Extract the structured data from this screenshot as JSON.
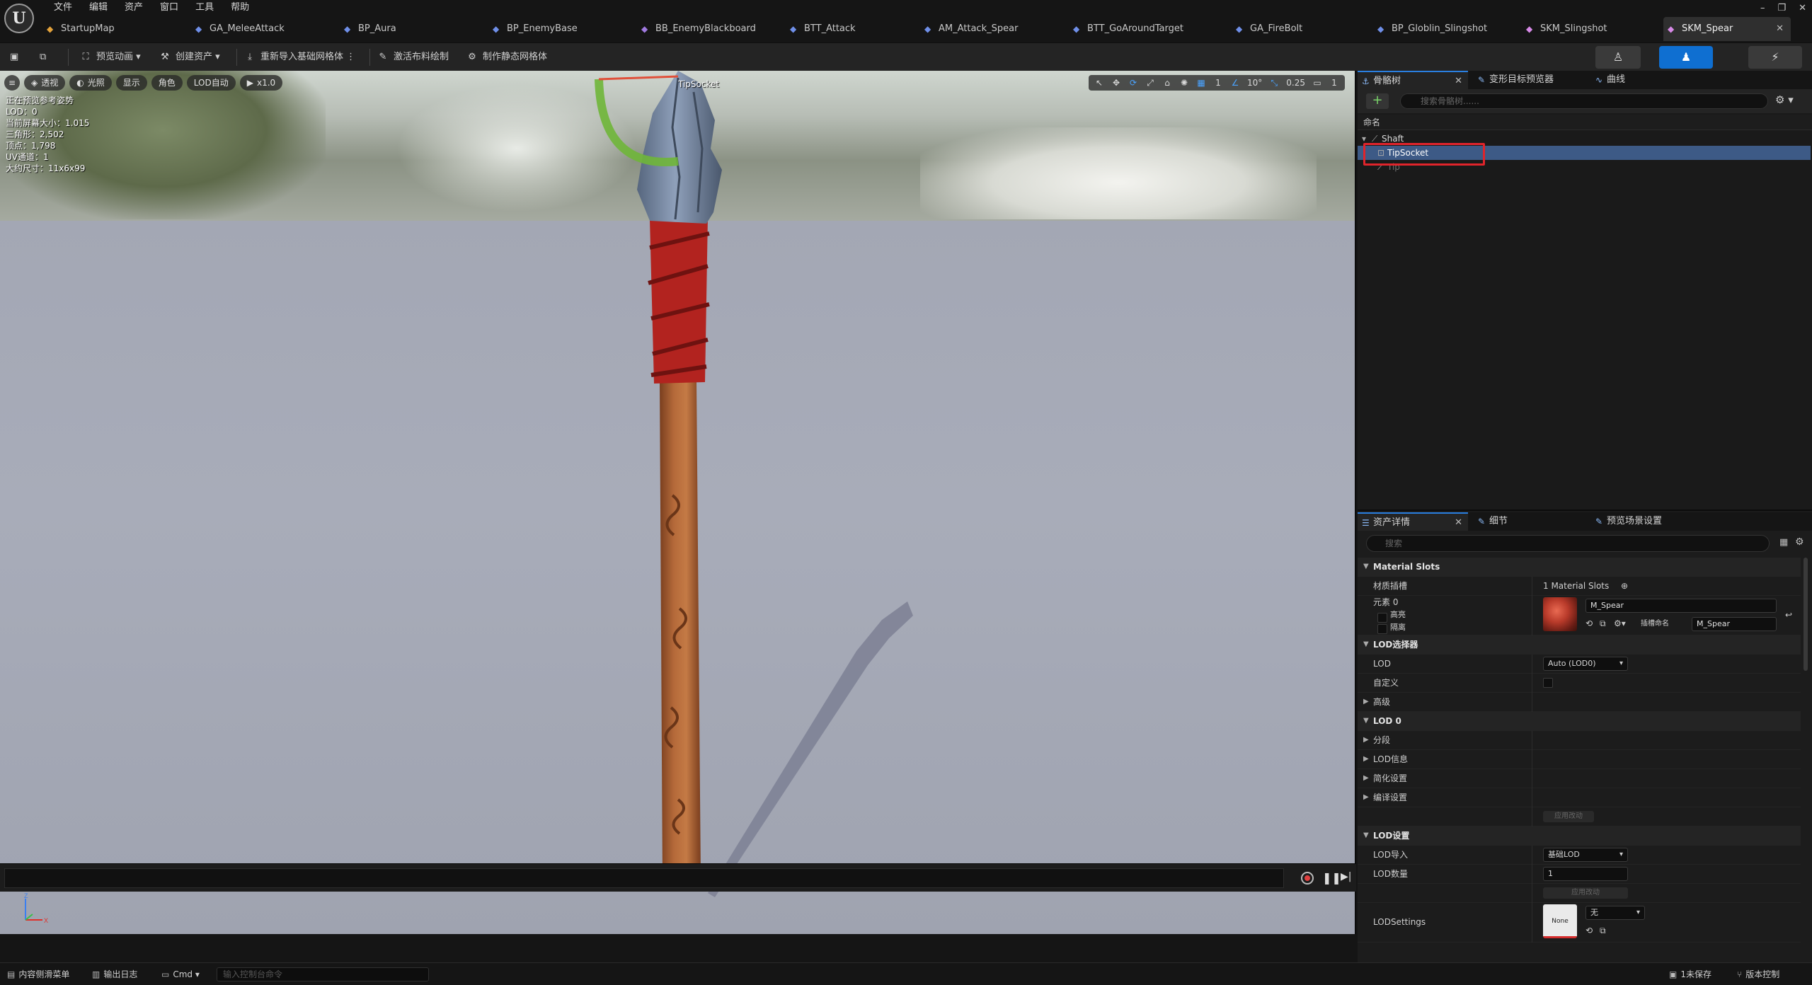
{
  "window": {
    "menu": [
      "文件",
      "编辑",
      "资产",
      "窗口",
      "工具",
      "帮助"
    ],
    "controls": [
      "–",
      "❐",
      "✕"
    ]
  },
  "tabs": [
    {
      "label": "StartupMap",
      "icon": "level-icon",
      "color": "#e3a23b"
    },
    {
      "label": "GA_MeleeAttack",
      "icon": "blueprint-icon",
      "color": "#6f8fe8"
    },
    {
      "label": "BP_Aura",
      "icon": "blueprint-icon",
      "color": "#6f8fe8"
    },
    {
      "label": "BP_EnemyBase",
      "icon": "blueprint-icon",
      "color": "#6f8fe8"
    },
    {
      "label": "BB_EnemyBlackboard",
      "icon": "blackboard-icon",
      "color": "#a07ae0"
    },
    {
      "label": "BTT_Attack",
      "icon": "blueprint-icon",
      "color": "#6f8fe8"
    },
    {
      "label": "AM_Attack_Spear",
      "icon": "montage-icon",
      "color": "#6f8fe8"
    },
    {
      "label": "BTT_GoAroundTarget",
      "icon": "blueprint-icon",
      "color": "#6f8fe8"
    },
    {
      "label": "GA_FireBolt",
      "icon": "blueprint-icon",
      "color": "#6f8fe8"
    },
    {
      "label": "BP_Globlin_Slingshot",
      "icon": "blueprint-icon",
      "color": "#6f8fe8"
    },
    {
      "label": "SKM_Slingshot",
      "icon": "skeletal-mesh-icon",
      "color": "#d88ae8"
    },
    {
      "label": "SKM_Spear",
      "icon": "skeletal-mesh-icon",
      "color": "#d88ae8",
      "active": true
    }
  ],
  "toolbar": {
    "preview_anim": "预览动画",
    "create_asset": "创建资产",
    "reimport_base_mesh": "重新导入基础网格体",
    "activate_cloth_paint": "激活布料绘制",
    "make_static_mesh": "制作静态网格体"
  },
  "viewport": {
    "pills": {
      "perspective": "透视",
      "lit": "光照",
      "show": "显示",
      "character": "角色",
      "lod_auto": "LOD自动",
      "speed": "x1.0"
    },
    "right_controls": {
      "layers": "1",
      "angle_snap": "10°",
      "scale_snap": "0.25",
      "camera_speed": "1"
    },
    "stats": [
      "正在预览参考姿势",
      "LOD：0",
      "当前屏幕大小：1.015",
      "三角形：2,502",
      "顶点：1,798",
      "UV通道：1",
      "大约尺寸：11x6x99"
    ],
    "socket_label": "TipSocket",
    "axis": {
      "z": "Z",
      "x": "X",
      "y": "Y"
    }
  },
  "skeleton_panel": {
    "tabs": [
      "骨骼树",
      "变形目标预览器",
      "曲线"
    ],
    "search_placeholder": "搜索骨骼树......",
    "column_header": "命名",
    "tree": [
      {
        "label": "Shaft",
        "level": 0,
        "type": "bone"
      },
      {
        "label": "TipSocket",
        "level": 1,
        "type": "socket",
        "selected": true
      },
      {
        "label": "Tip",
        "level": 1,
        "type": "bone",
        "dim": true
      }
    ]
  },
  "details_panel": {
    "tabs": [
      "资产详情",
      "细节",
      "预览场景设置"
    ],
    "search_placeholder": "搜索",
    "material_slots": {
      "category": "Material Slots",
      "label": "材质插槽",
      "count": "1 Material Slots",
      "element": "元素 0",
      "highlight": "高亮",
      "isolate": "隔离",
      "material": "M_Spear",
      "slot_name_label": "插槽命名",
      "slot_name": "M_Spear"
    },
    "lod_picker": {
      "category": "LOD选择器",
      "lod_label": "LOD",
      "lod_value": "Auto (LOD0)",
      "custom_label": "自定义",
      "advanced": "高级"
    },
    "lod0": {
      "category": "LOD 0",
      "sections": "分段",
      "lod_info": "LOD信息",
      "reduction": "简化设置",
      "build": "编译设置",
      "apply": "应用改动"
    },
    "lod_settings": {
      "category": "LOD设置",
      "import_label": "LOD导入",
      "import_value": "基础LOD",
      "count_label": "LOD数量",
      "count_value": "1",
      "apply": "应用改动",
      "settings_label": "LODSettings",
      "settings_thumb": "None",
      "settings_value": "无"
    }
  },
  "statusbar": {
    "content_drawer": "内容侧滑菜单",
    "output_log": "输出日志",
    "cmd": "Cmd",
    "cmd_placeholder": "输入控制台命令",
    "unsaved": "1未保存",
    "source_control": "版本控制"
  }
}
